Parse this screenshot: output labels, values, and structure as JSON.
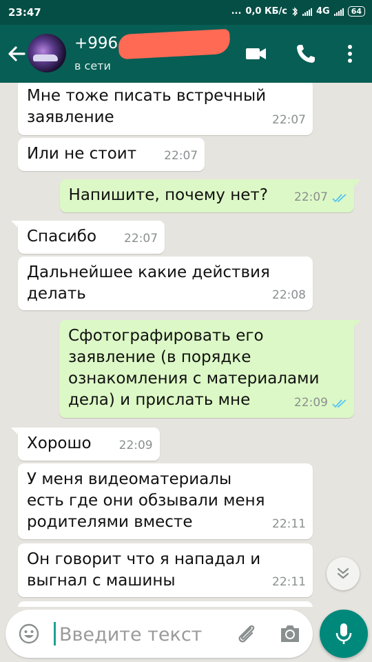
{
  "status_bar": {
    "time": "23:47",
    "dots": "...",
    "net_speed": "0,0 КБ/с",
    "network": "4G",
    "battery": "64"
  },
  "header": {
    "contact_prefix": "+996",
    "status": "в сети",
    "icons": [
      "back-arrow-icon",
      "video-call-icon",
      "phone-icon",
      "more-options-icon"
    ]
  },
  "messages": [
    {
      "dir": "in",
      "text": "Мне тоже писать встречный\nзаявление",
      "time": "22:07"
    },
    {
      "dir": "in",
      "text": "Или не стоит",
      "time": "22:07"
    },
    {
      "dir": "out",
      "text": "Напишите, почему нет?",
      "time": "22:07",
      "read": true
    },
    {
      "dir": "in",
      "text": "Спасибо",
      "time": "22:07"
    },
    {
      "dir": "in",
      "text": "Дальнейшее какие действия\nделать",
      "time": "22:08"
    },
    {
      "dir": "out",
      "text": "Сфотографировать его\nзаявление (в порядке\nознакомления с материалами\nдела) и прислать мне",
      "time": "22:09",
      "read": true
    },
    {
      "dir": "in",
      "text": "Хорошо",
      "time": "22:09"
    },
    {
      "dir": "in",
      "text": "У меня видеоматериалы\nесть где они обзывали меня\nродителями вместе",
      "time": "22:11"
    },
    {
      "dir": "in",
      "text": "Он говорит что я нападал и\nвыгнал с машины",
      "time": "22:11"
    }
  ],
  "composer": {
    "placeholder": "Введите текст",
    "icons": [
      "emoji-icon",
      "attach-icon",
      "camera-icon",
      "mic-icon"
    ]
  },
  "colors": {
    "header": "#075e54",
    "status_bar": "#054e45",
    "outgoing_bubble": "#dcf8c6",
    "incoming_bubble": "#ffffff",
    "read_ticks": "#4fc3f7",
    "mic_button": "#00897b"
  }
}
